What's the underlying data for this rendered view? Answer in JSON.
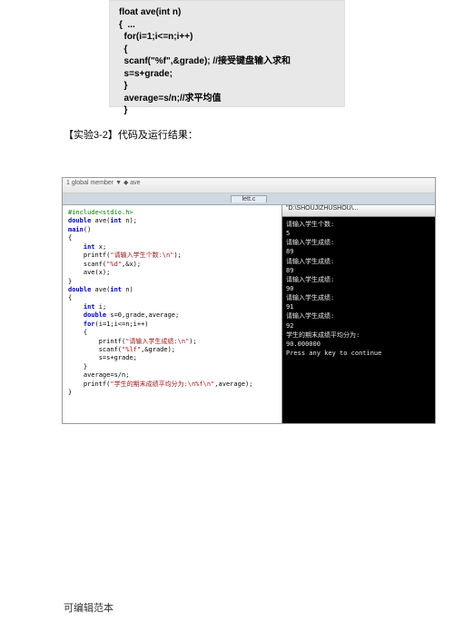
{
  "topbox": {
    "code": "float ave(int n)\n{  ...\n  for(i=1;i<=n;i++)\n  {\n  scanf(\"%f\",&grade); //接受键盘输入求和\n  s=s+grade;\n  }\n  average=s/n;//求平均值\n  }"
  },
  "caption": "【实验3-2】代码及运行结果：",
  "ide": {
    "toolbar": "1 global member    ▼  ◆ ave",
    "tab": "lett.c",
    "code_lines": [
      {
        "cls": "pp",
        "t": "#include<stdio.h>"
      },
      {
        "cls": "kw",
        "t": "double ave(int n);"
      },
      {
        "cls": "",
        "t": "main()"
      },
      {
        "cls": "",
        "t": "{"
      },
      {
        "cls": "",
        "t": "    int x;"
      },
      {
        "cls": "",
        "t": "    printf(\"请输入学生个数:\\n\");"
      },
      {
        "cls": "",
        "t": "    scanf(\"%d\",&x);"
      },
      {
        "cls": "",
        "t": "    ave(x);"
      },
      {
        "cls": "",
        "t": "}"
      },
      {
        "cls": "kw",
        "t": "double ave(int n)"
      },
      {
        "cls": "",
        "t": "{"
      },
      {
        "cls": "",
        "t": "    int i;"
      },
      {
        "cls": "",
        "t": "    double s=0,grade,average;"
      },
      {
        "cls": "",
        "t": "    for(i=1;i<=n;i++)"
      },
      {
        "cls": "",
        "t": "    {"
      },
      {
        "cls": "",
        "t": "        printf(\"请输入学生成绩:\\n\");"
      },
      {
        "cls": "",
        "t": "        scanf(\"%lf\",&grade);"
      },
      {
        "cls": "",
        "t": "        s=s+grade;"
      },
      {
        "cls": "",
        "t": "    }"
      },
      {
        "cls": "",
        "t": "    average=s/n;"
      },
      {
        "cls": "",
        "t": "    printf(\"学生的期末成绩平均分为:\\n%f\\n\",average);"
      },
      {
        "cls": "",
        "t": "}"
      }
    ],
    "term_title": "\"D:\\SHOUJIZHUSHOU\\..."
  },
  "terminal": {
    "lines": [
      "请输入学生个数:",
      "5",
      "请输入学生成绩:",
      "89",
      "请输入学生成绩:",
      "89",
      "请输入学生成绩:",
      "90",
      "请输入学生成绩:",
      "91",
      "请输入学生成绩:",
      "92",
      "学生的期末成绩平均分为:",
      "90.000000",
      "Press any key to continue"
    ]
  },
  "footer": "可编辑范本"
}
